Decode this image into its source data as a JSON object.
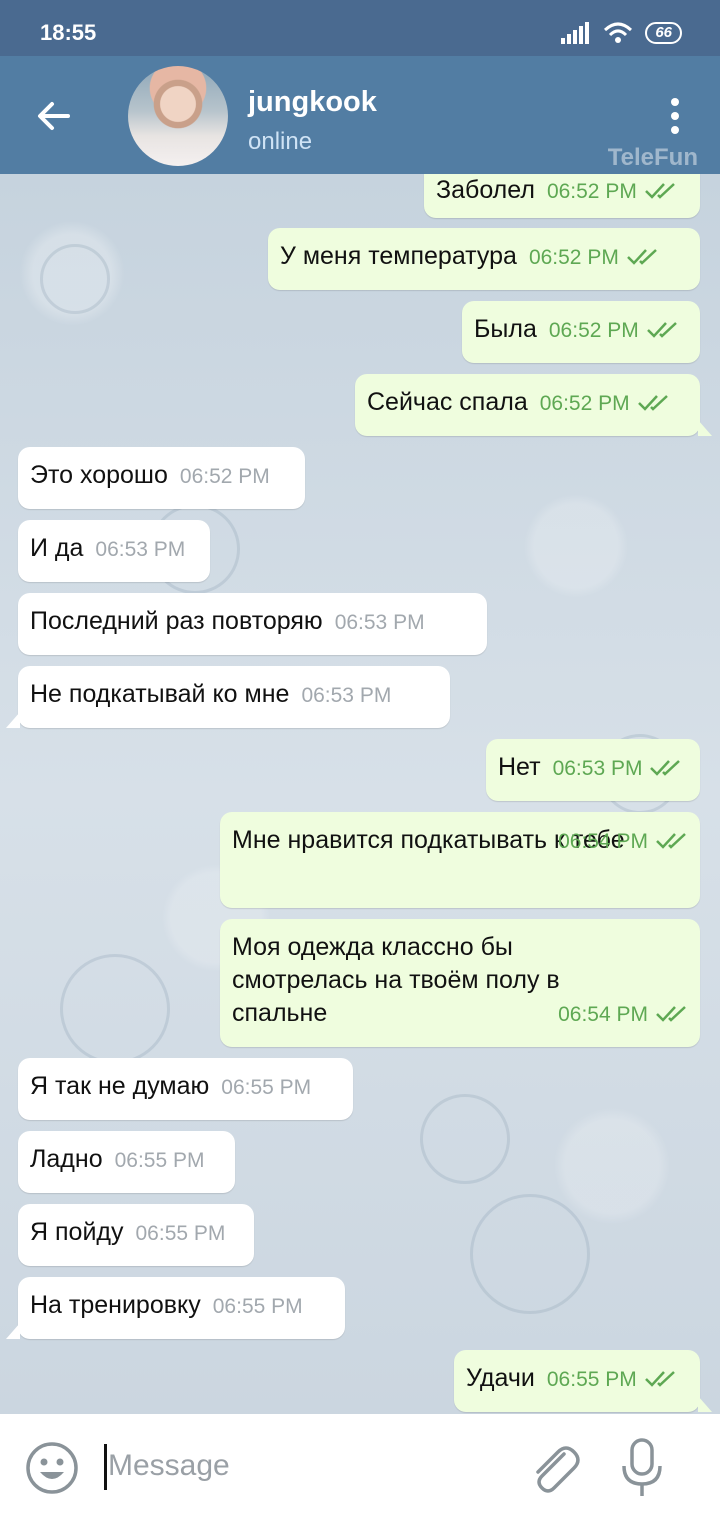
{
  "status": {
    "time": "18:55",
    "battery": "66"
  },
  "header": {
    "name": "jungkook",
    "status": "online",
    "watermark": "TeleFun"
  },
  "input": {
    "placeholder": "Message"
  },
  "messages": [
    {
      "dir": "out",
      "text": "Заболел",
      "time": "06:52 PM"
    },
    {
      "dir": "out",
      "text": "У меня температура",
      "time": "06:52 PM"
    },
    {
      "dir": "out",
      "text": "Была",
      "time": "06:52 PM"
    },
    {
      "dir": "out",
      "text": "Сейчас спала",
      "time": "06:52 PM"
    },
    {
      "dir": "in",
      "text": "Это хорошо",
      "time": "06:52 PM"
    },
    {
      "dir": "in",
      "text": "И да",
      "time": "06:53 PM"
    },
    {
      "dir": "in",
      "text": "Последний раз повторяю",
      "time": "06:53 PM"
    },
    {
      "dir": "in",
      "text": "Не подкатывай ко мне",
      "time": "06:53 PM"
    },
    {
      "dir": "out",
      "text": "Нет",
      "time": "06:53 PM"
    },
    {
      "dir": "out",
      "text": "Мне нравится подкатывать к тебе",
      "time": "06:54 PM"
    },
    {
      "dir": "out",
      "text": "Моя одежда классно бы смотрелась на твоём полу в спальне",
      "time": "06:54 PM"
    },
    {
      "dir": "in",
      "text": "Я так не думаю",
      "time": "06:55 PM"
    },
    {
      "dir": "in",
      "text": "Ладно",
      "time": "06:55 PM"
    },
    {
      "dir": "in",
      "text": "Я пойду",
      "time": "06:55 PM"
    },
    {
      "dir": "in",
      "text": "На тренировку",
      "time": "06:55 PM"
    },
    {
      "dir": "out",
      "text": "Удачи",
      "time": "06:55 PM"
    }
  ]
}
